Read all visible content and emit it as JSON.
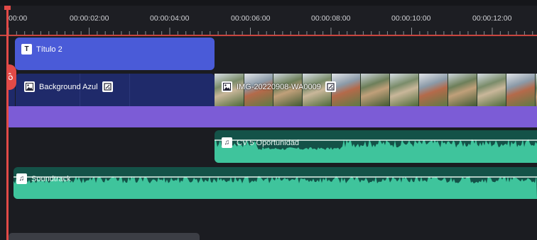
{
  "ruler": {
    "times": [
      "00:00",
      "00:00:02:00",
      "00:00:04:00",
      "00:00:06:00",
      "00:00:08:00",
      "00:00:10:00",
      "00:00:12:00"
    ]
  },
  "tracks": {
    "title_clip": {
      "label": "Título 2",
      "icon": "text-icon"
    },
    "background_clip": {
      "label": "Background Azul",
      "icon": "image-icon",
      "badge": "effect-badge-icon"
    },
    "image_clip": {
      "label": "IMG-20220908-WA0009",
      "icon": "image-icon",
      "badge": "effect-badge-icon"
    },
    "audio_clip": {
      "label": "CV 5 Oportunidad",
      "icon": "music-icon"
    },
    "soundtrack_clip": {
      "label": "Soundtrack",
      "icon": "music-icon"
    }
  },
  "colors": {
    "title": "#4a5bd8",
    "background": "#1f2a6a",
    "purple": "#7c5cd6",
    "audio": "#145248",
    "wave": "#3fc49c",
    "playhead": "#e24a47"
  }
}
